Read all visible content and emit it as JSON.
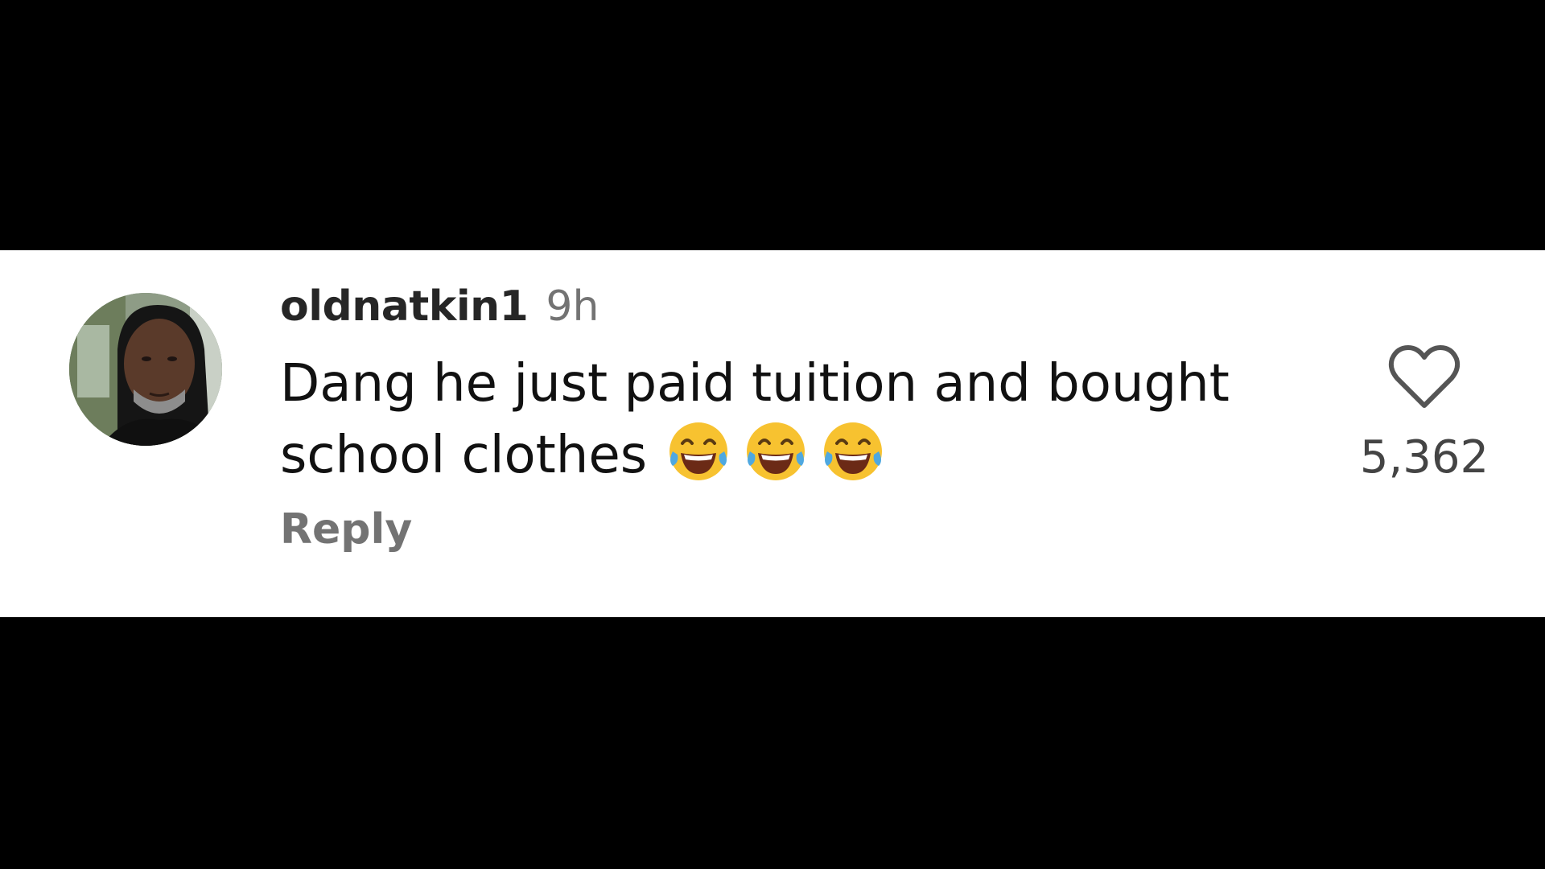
{
  "comment": {
    "username": "oldnatkin1",
    "timestamp": "9h",
    "text": "Dang he just paid tuition and bought school clothes",
    "emojis": [
      "face-with-tears-of-joy",
      "face-with-tears-of-joy",
      "face-with-tears-of-joy"
    ],
    "reply_label": "Reply",
    "like_count": "5,362",
    "like_icon": "heart-outline-icon"
  },
  "colors": {
    "background": "#000000",
    "card": "#ffffff",
    "username": "#262626",
    "muted": "#737373",
    "text": "#111111"
  }
}
